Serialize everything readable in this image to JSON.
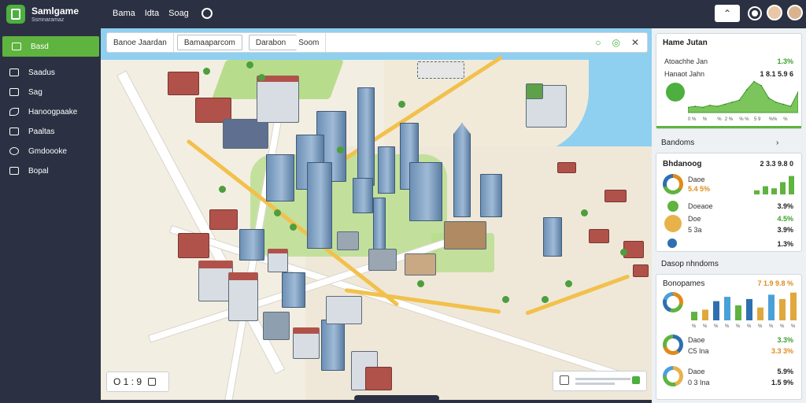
{
  "app": {
    "title": "Samlgame",
    "subtitle": "Ssmnaramaz"
  },
  "topnav": [
    "Bama",
    "Idta",
    "Soag"
  ],
  "sidebar": {
    "items": [
      {
        "label": "Basd",
        "icon": "map-icon",
        "active": true
      },
      {
        "label": "Saadus",
        "icon": "layers-icon",
        "active": false
      },
      {
        "label": "Sag",
        "icon": "database-icon",
        "active": false
      },
      {
        "label": "Hanoogpaake",
        "icon": "wrench-icon",
        "active": false
      },
      {
        "label": "Paaltas",
        "icon": "settings-icon",
        "active": false
      },
      {
        "label": "Gmdoooke",
        "icon": "globe-icon",
        "active": false
      },
      {
        "label": "Bopal",
        "icon": "user-icon",
        "active": false
      }
    ]
  },
  "search": {
    "tabs": [
      "Banoe Jaardan",
      "Bamaaparcom",
      "Darabon",
      "Soom"
    ]
  },
  "zoom": {
    "label": "O 1 : 9"
  },
  "panel": {
    "top": {
      "title": "Hame Jutan",
      "row1_label": "Atoachhe Jan",
      "row1_value": "1.3%",
      "row2_label": "Hanaot Jahn",
      "row2_value": "1 8.1 5.9 6"
    },
    "section1": {
      "title": "Bandoms"
    },
    "card2": {
      "title": "Bhdanoog",
      "title_value": "2 3.3 9.8 0",
      "rows": [
        {
          "label": "Daoe",
          "sub": "5.4 5%",
          "value": "3.9 %",
          "color": "#e08a1c"
        },
        {
          "label": "Doeaoe",
          "value": "3.9%",
          "color": "#5fb33f"
        },
        {
          "label": "Doe",
          "value": "4.5%",
          "color": "#5fb33f"
        },
        {
          "label": "5 3a",
          "value": "3.9%",
          "color": "#e0a83c"
        },
        {
          "label": "",
          "value": "1.3%",
          "color": "#2f6fb0"
        }
      ]
    },
    "section2": {
      "title": "Dasop nhndoms"
    },
    "card3": {
      "title": "Bonopames",
      "title_value": "7 1.9 9.8 %",
      "rows": [
        {
          "label": "Daoe",
          "value": "3.3%"
        },
        {
          "label": "C5 Ina",
          "value": "3.3 3%"
        },
        {
          "label": "Daoe",
          "value": "5.9%"
        },
        {
          "label": "0 3 Ina",
          "value": "1.5 9%"
        }
      ]
    }
  },
  "chart_data": [
    {
      "type": "area",
      "x": [
        1,
        2,
        3,
        4,
        5,
        6,
        7,
        8,
        9,
        10,
        11,
        12,
        13,
        14,
        15,
        16
      ],
      "values": [
        5,
        6,
        5,
        7,
        6,
        8,
        10,
        12,
        22,
        30,
        26,
        14,
        10,
        8,
        6,
        20
      ],
      "tick_labels": [
        "0 %",
        "",
        "%",
        "",
        "%",
        "2 %",
        "",
        "% %",
        "",
        "5 9",
        "",
        "%%",
        "",
        "%",
        "",
        "%"
      ]
    },
    {
      "type": "bar",
      "values": [
        4,
        8,
        6,
        12,
        18
      ],
      "colors": [
        "#5fb33f",
        "#5fb33f",
        "#5fb33f",
        "#5fb33f",
        "#5fb33f"
      ]
    },
    {
      "type": "bar",
      "values": [
        8,
        10,
        18,
        22,
        14,
        20,
        12,
        24,
        20,
        26
      ],
      "colors": [
        "#5fb33f",
        "#e0a83c",
        "#2f6fb0",
        "#4aa0d8",
        "#5fb33f",
        "#2f6fb0",
        "#e0a83c",
        "#4aa0d8",
        "#e0a83c",
        "#e0a83c"
      ],
      "tick_labels": [
        "%",
        "%",
        "%",
        "%",
        "%",
        "%",
        "%",
        "%",
        "%",
        "%"
      ]
    }
  ]
}
